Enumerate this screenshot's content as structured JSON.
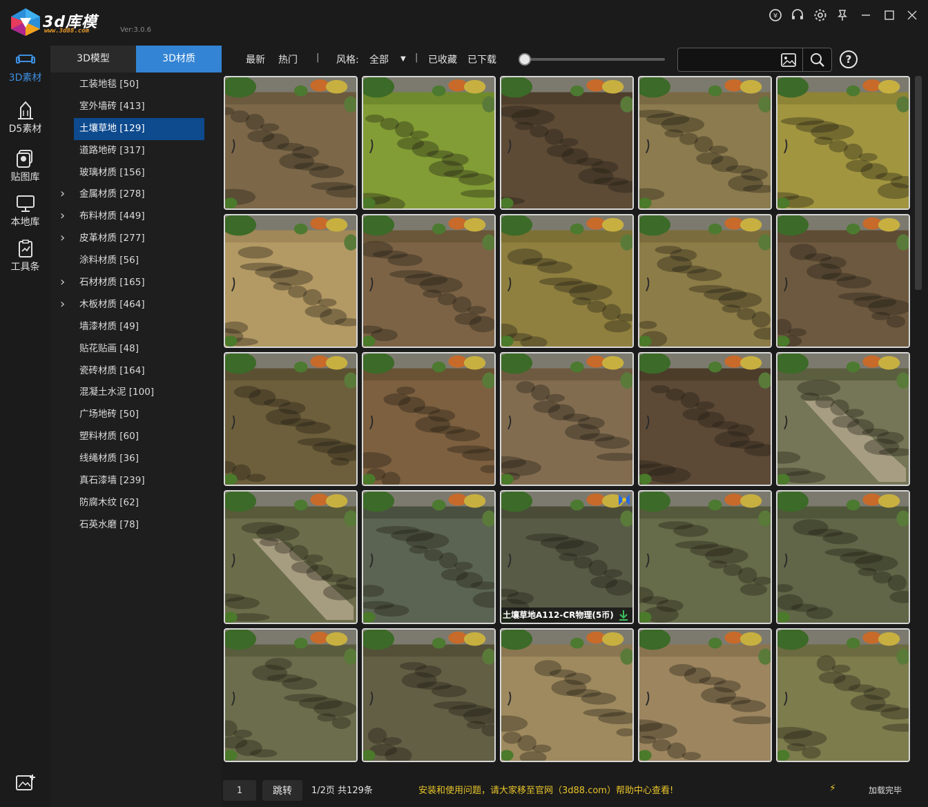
{
  "app": {
    "logo_text": "3d库模",
    "logo_sub": "www.3d88.com",
    "version": "Ver:3.0.6"
  },
  "window_controls": [
    "coin-icon",
    "headset-icon",
    "gear-icon",
    "pin-icon",
    "minimize-icon",
    "maximize-icon",
    "close-icon"
  ],
  "rail": [
    {
      "label": "3D素材",
      "icon": "sofa-icon",
      "active": true
    },
    {
      "label": "D5素材",
      "icon": "building-icon",
      "active": false
    },
    {
      "label": "贴图库",
      "icon": "image-stack-icon",
      "active": false
    },
    {
      "label": "本地库",
      "icon": "monitor-icon",
      "active": false
    },
    {
      "label": "工具条",
      "icon": "clipboard-icon",
      "active": false
    }
  ],
  "category_tabs": [
    {
      "label": "3D模型",
      "active": false
    },
    {
      "label": "3D材质",
      "active": true
    }
  ],
  "categories": [
    {
      "label": "工装地毯 [50]",
      "expandable": false,
      "selected": false
    },
    {
      "label": "室外墙砖 [413]",
      "expandable": false,
      "selected": false
    },
    {
      "label": "土壤草地 [129]",
      "expandable": false,
      "selected": true
    },
    {
      "label": "道路地砖 [317]",
      "expandable": false,
      "selected": false
    },
    {
      "label": "玻璃材质 [156]",
      "expandable": false,
      "selected": false
    },
    {
      "label": "金属材质 [278]",
      "expandable": true,
      "selected": false
    },
    {
      "label": "布料材质 [449]",
      "expandable": true,
      "selected": false
    },
    {
      "label": "皮革材质 [277]",
      "expandable": true,
      "selected": false
    },
    {
      "label": "涂料材质 [56]",
      "expandable": false,
      "selected": false
    },
    {
      "label": "石材材质 [165]",
      "expandable": true,
      "selected": false
    },
    {
      "label": "木板材质 [464]",
      "expandable": true,
      "selected": false
    },
    {
      "label": "墙漆材质 [49]",
      "expandable": false,
      "selected": false
    },
    {
      "label": "贴花贴画 [48]",
      "expandable": false,
      "selected": false
    },
    {
      "label": "瓷砖材质 [164]",
      "expandable": false,
      "selected": false
    },
    {
      "label": "混凝土水泥 [100]",
      "expandable": false,
      "selected": false
    },
    {
      "label": "广场地砖 [50]",
      "expandable": false,
      "selected": false
    },
    {
      "label": "塑料材质 [60]",
      "expandable": false,
      "selected": false
    },
    {
      "label": "线绳材质 [36]",
      "expandable": false,
      "selected": false
    },
    {
      "label": "真石漆墙 [239]",
      "expandable": false,
      "selected": false
    },
    {
      "label": "防腐木纹 [62]",
      "expandable": false,
      "selected": false
    },
    {
      "label": "石英水磨 [78]",
      "expandable": false,
      "selected": false
    }
  ],
  "toolbar": {
    "newest": "最新",
    "popular": "热门",
    "sep": "|",
    "style_label": "风格:",
    "style_value": "全部",
    "favorited": "已收藏",
    "downloaded": "已下载",
    "search_placeholder": ""
  },
  "tiles": [
    {
      "ground": "#6b5a3e",
      "tone": "#8a7352"
    },
    {
      "ground": "#6e8a2c",
      "tone": "#93ad3e"
    },
    {
      "ground": "#4e3f2c",
      "tone": "#6a5640"
    },
    {
      "ground": "#7a6a44",
      "tone": "#9a8858"
    },
    {
      "ground": "#8e8436",
      "tone": "#b0a448"
    },
    {
      "ground": "#a08858",
      "tone": "#c2a870"
    },
    {
      "ground": "#6a5638",
      "tone": "#8a7050"
    },
    {
      "ground": "#7c7034",
      "tone": "#9e8e48"
    },
    {
      "ground": "#7a6c3c",
      "tone": "#9a8a50"
    },
    {
      "ground": "#5e4c34",
      "tone": "#7a6448"
    },
    {
      "ground": "#5c5032",
      "tone": "#7c6c44"
    },
    {
      "ground": "#6a5234",
      "tone": "#8c6c48"
    },
    {
      "ground": "#6e5a40",
      "tone": "#947c5c"
    },
    {
      "ground": "#4c3c2a",
      "tone": "#6a5440"
    },
    {
      "ground": "#5c5e40",
      "tone": "#8a8a6a",
      "path": true
    },
    {
      "ground": "#585a3a",
      "tone": "#7c7e58",
      "path": true
    },
    {
      "ground": "#4a5040",
      "tone": "#6a7460"
    },
    {
      "ground": "#4a4c38",
      "tone": "#646852",
      "label": "土壤草地A112-CR物理(5币)",
      "badge": true
    },
    {
      "ground": "#555a3c",
      "tone": "#747a54"
    },
    {
      "ground": "#50563a",
      "tone": "#6e7452"
    },
    {
      "ground": "#5a5c3e",
      "tone": "#7a7c58"
    },
    {
      "ground": "#545038",
      "tone": "#706c50"
    },
    {
      "ground": "#8a7650",
      "tone": "#b09a6c"
    },
    {
      "ground": "#8a7450",
      "tone": "#ac946c"
    },
    {
      "ground": "#6c6a40",
      "tone": "#8c8a58"
    }
  ],
  "bottom": {
    "page_value": "1",
    "jump": "跳转",
    "page_info": "1/2页 共129条",
    "notice": "安装和使用问题，请大家移至官网（3d88.com）帮助中心查看!",
    "bolt": "⚡",
    "loaded": "加载完毕"
  },
  "colors": {
    "accent": "#3384d4",
    "selected": "#0d4a8e",
    "notice": "#e8c42a"
  }
}
